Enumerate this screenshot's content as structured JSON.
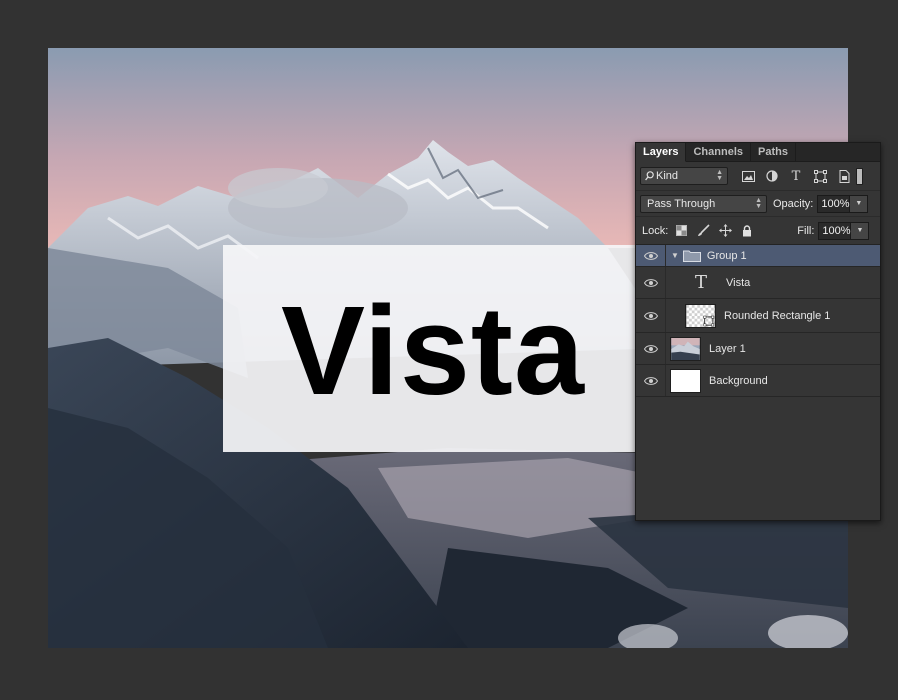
{
  "canvas": {
    "overlay_text": "Vista",
    "colors": {
      "sky_top": "#8a9bb1",
      "sky_pink": "#e8b8b6",
      "forest": "#2a3442",
      "snow": "#e6e9ee"
    }
  },
  "layers_panel": {
    "tabs": [
      {
        "label": "Layers",
        "active": true
      },
      {
        "label": "Channels",
        "active": false
      },
      {
        "label": "Paths",
        "active": false
      }
    ],
    "filter": {
      "kind_label": "Kind",
      "icons": [
        "image-filter-icon",
        "adjustment-filter-icon",
        "type-filter-icon",
        "shape-filter-icon",
        "smart-object-filter-icon"
      ]
    },
    "blend_mode": "Pass Through",
    "opacity_label": "Opacity:",
    "opacity_value": "100%",
    "lock_label": "Lock:",
    "fill_label": "Fill:",
    "fill_value": "100%",
    "layers": [
      {
        "name": "Group 1",
        "type": "group",
        "selected": true
      },
      {
        "name": "Vista",
        "type": "text"
      },
      {
        "name": "Rounded Rectangle 1",
        "type": "shape"
      },
      {
        "name": "Layer 1",
        "type": "image"
      },
      {
        "name": "Background",
        "type": "background"
      }
    ],
    "colors": {
      "panel_bg": "#353535",
      "selected_row": "#4d5a73"
    }
  }
}
